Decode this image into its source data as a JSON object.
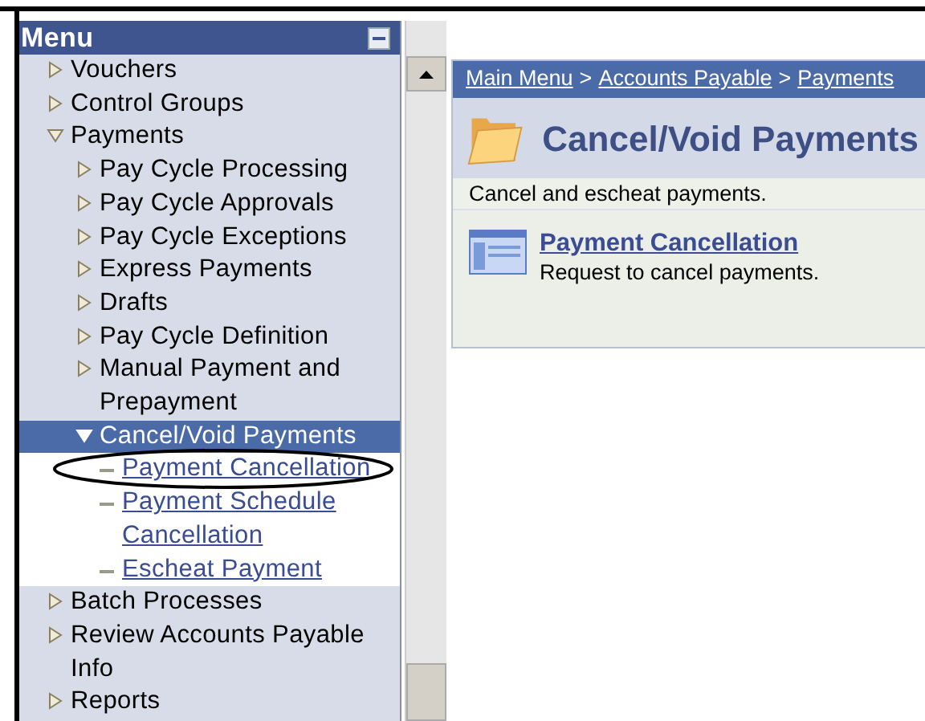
{
  "menu": {
    "title": "Menu",
    "items": [
      {
        "label": "Vouchers",
        "kind": "folder",
        "expanded": false,
        "selected": false
      },
      {
        "label": "Control Groups",
        "kind": "folder",
        "expanded": false,
        "selected": false
      },
      {
        "label": "Payments",
        "kind": "folder",
        "expanded": true,
        "selected": false,
        "children": [
          {
            "label": "Pay Cycle Processing",
            "kind": "folder",
            "expanded": false,
            "selected": false
          },
          {
            "label": "Pay Cycle Approvals",
            "kind": "folder",
            "expanded": false,
            "selected": false
          },
          {
            "label": "Pay Cycle Exceptions",
            "kind": "folder",
            "expanded": false,
            "selected": false
          },
          {
            "label": "Express Payments",
            "kind": "folder",
            "expanded": false,
            "selected": false
          },
          {
            "label": "Drafts",
            "kind": "folder",
            "expanded": false,
            "selected": false
          },
          {
            "label": "Pay Cycle Definition",
            "kind": "folder",
            "expanded": false,
            "selected": false
          },
          {
            "label": "Manual Payment and Prepayment",
            "kind": "folder",
            "expanded": false,
            "selected": false
          },
          {
            "label": "Cancel/Void Payments",
            "kind": "folder",
            "expanded": true,
            "selected": true,
            "children": [
              {
                "label": "Payment Cancellation",
                "kind": "link",
                "selected": false
              },
              {
                "label": "Payment Schedule Cancellation",
                "kind": "link",
                "selected": false
              },
              {
                "label": "Escheat Payment",
                "kind": "link",
                "selected": false
              }
            ]
          }
        ]
      },
      {
        "label": "Batch Processes",
        "kind": "folder",
        "expanded": false,
        "selected": false
      },
      {
        "label": "Review Accounts Payable Info",
        "kind": "folder",
        "expanded": false,
        "selected": false
      },
      {
        "label": "Reports",
        "kind": "folder",
        "expanded": false,
        "selected": false
      }
    ]
  },
  "breadcrumb": {
    "separator": ">",
    "items": [
      "Main Menu",
      "Accounts Payable",
      "Payments"
    ]
  },
  "page": {
    "title": "Cancel/Void Payments",
    "description": "Cancel and escheat payments.",
    "entries": [
      {
        "title": "Payment Cancellation",
        "description": "Request to cancel payments."
      }
    ]
  }
}
